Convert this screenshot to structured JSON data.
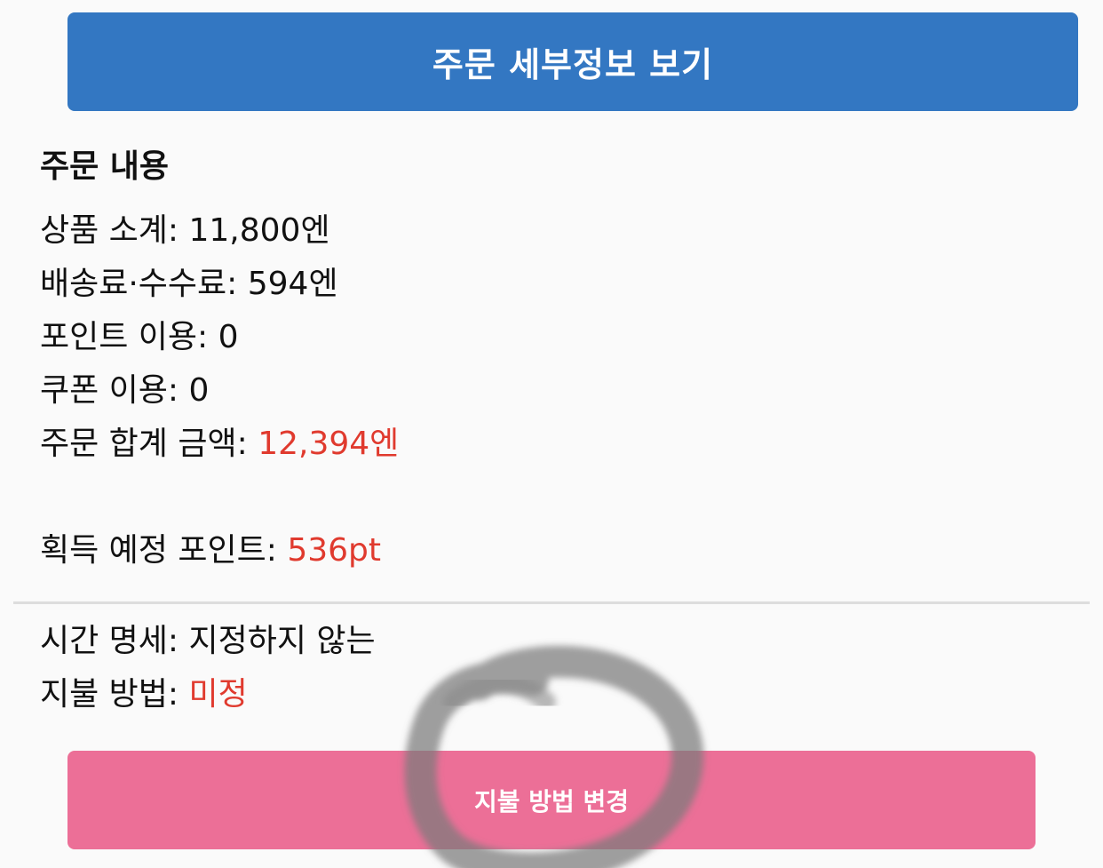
{
  "header": {
    "view_details_label": "주문 세부정보 보기"
  },
  "order_summary": {
    "title": "주문 내용",
    "subtotal_label": "상품 소계: ",
    "subtotal_value": "11,800엔",
    "shipping_label": "배송료·수수료: ",
    "shipping_value": "594엔",
    "points_used_label": "포인트 이용: ",
    "points_used_value": "0",
    "coupon_used_label": "쿠폰 이용: ",
    "coupon_used_value": "0",
    "total_label": "주문 합계 금액: ",
    "total_value": "12,394엔",
    "earned_points_label": "획득 예정 포인트: ",
    "earned_points_value": "536pt"
  },
  "delivery": {
    "time_label": "시간 명세: ",
    "time_value": "지정하지 않는",
    "payment_label": "지불 방법: ",
    "payment_value": "미정"
  },
  "footer": {
    "change_payment_label": "지불 방법 변경"
  },
  "colors": {
    "primary_blue": "#3377c2",
    "accent_pink": "#ec6f97",
    "highlight_red": "#e03a2e",
    "background": "#fafafa"
  }
}
